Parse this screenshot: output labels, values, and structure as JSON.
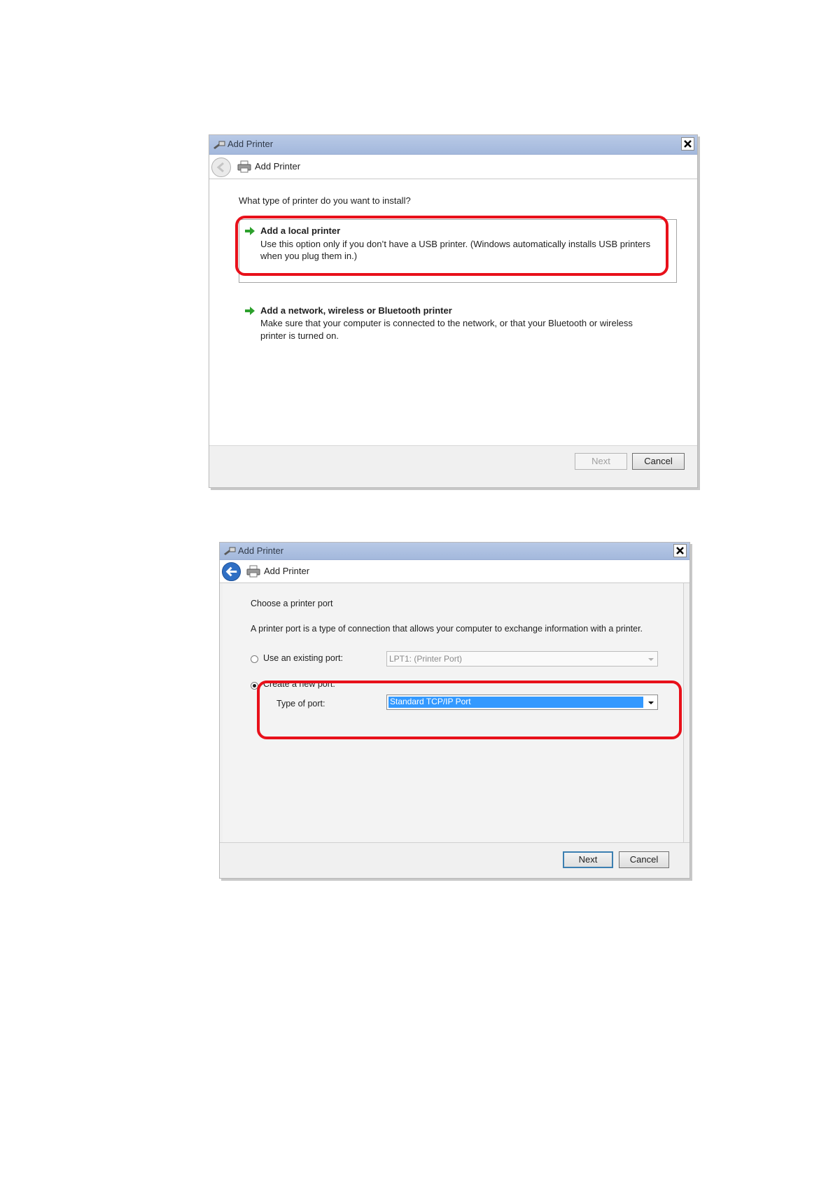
{
  "dialog1": {
    "window_title": "Add Printer",
    "nav_title": "Add Printer",
    "question": "What type of printer do you want to install?",
    "options": [
      {
        "title": "Add a local printer",
        "desc_line1": "Use this option only if you don’t have a USB printer. (Windows automatically installs USB printers",
        "desc_line2": "when you plug them in.)"
      },
      {
        "title": "Add a network, wireless or Bluetooth printer",
        "desc_line1": "Make sure that your computer is connected to the network, or that your Bluetooth or wireless",
        "desc_line2": "printer is turned on."
      }
    ],
    "buttons": {
      "next": "Next",
      "cancel": "Cancel"
    }
  },
  "dialog2": {
    "window_title": "Add Printer",
    "nav_title": "Add Printer",
    "heading": "Choose a printer port",
    "description": "A printer port is a type of connection that allows your computer to exchange information with a printer.",
    "existing_port_label": "Use an existing port:",
    "existing_port_value": "LPT1: (Printer Port)",
    "new_port_label": "Create a new port:",
    "type_of_port_label": "Type of port:",
    "type_of_port_value": "Standard TCP/IP Port",
    "buttons": {
      "next": "Next",
      "cancel": "Cancel"
    }
  },
  "colors": {
    "highlight": "#e8101a",
    "selection": "#3399ff",
    "arrow": "#2ca02c"
  },
  "icons": [
    "printer-wizard-icon",
    "back-arrow-icon",
    "printer-icon",
    "green-arrow-icon",
    "close-icon",
    "dropdown-arrow-icon"
  ]
}
